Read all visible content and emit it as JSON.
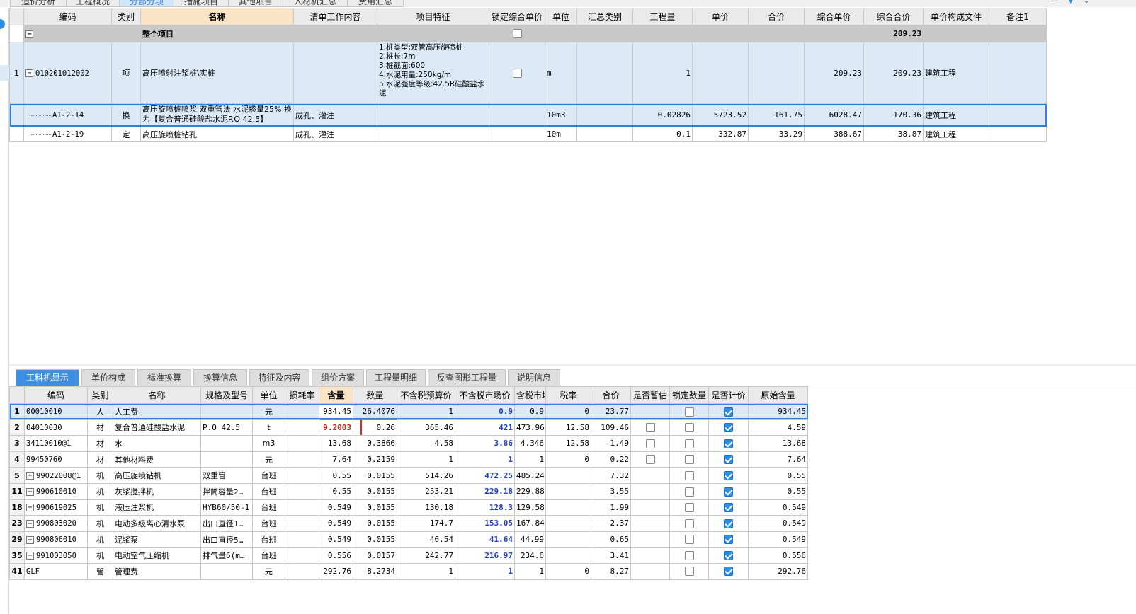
{
  "top_tabs": [
    "造价分析",
    "工程概况",
    "分部分项",
    "措施项目",
    "其他项目",
    "人材机汇总",
    "费用汇总"
  ],
  "upper": {
    "headers": [
      "编码",
      "类别",
      "名称",
      "清单工作内容",
      "项目特征",
      "锁定综合单价",
      "单位",
      "汇总类别",
      "工程量",
      "单价",
      "合价",
      "综合单价",
      "综合合价",
      "单价构成文件",
      "备注1"
    ],
    "whole": {
      "label": "整个项目",
      "total": "209.23"
    },
    "item": {
      "row_num": "1",
      "code": "010201012002",
      "type": "项",
      "name": "高压喷射注浆桩\\实桩",
      "features": "1.桩类型:双管高压旋喷桩\n2.桩长:7m\n3.桩截面:600\n4.水泥用量:250kg/m\n5.水泥强度等级:42.5R硅酸盐水泥",
      "unit": "m",
      "qty": "1",
      "comp_price": "209.23",
      "comp_total": "209.23",
      "file": "建筑工程"
    },
    "subs": [
      {
        "code": "A1-2-14",
        "type": "换",
        "name": "高压旋喷桩喷浆 双重管法 水泥掺量25% 换为【复合普通硅酸盐水泥P.O 42.5】",
        "work": "成孔、灌注",
        "unit": "10m3",
        "qty": "0.02826",
        "price": "5723.52",
        "total": "161.75",
        "comp_price": "6028.47",
        "comp_total": "170.36",
        "file": "建筑工程"
      },
      {
        "code": "A1-2-19",
        "type": "定",
        "name": "高压旋喷桩钻孔",
        "work": "成孔、灌注",
        "unit": "10m",
        "qty": "0.1",
        "price": "332.87",
        "total": "33.29",
        "comp_price": "388.67",
        "comp_total": "38.87",
        "file": "建筑工程"
      }
    ]
  },
  "lower_tabs": [
    "工料机显示",
    "单价构成",
    "标准换算",
    "换算信息",
    "特征及内容",
    "组价方案",
    "工程量明细",
    "反查图形工程量",
    "说明信息"
  ],
  "lower": {
    "headers": [
      "编码",
      "类别",
      "名称",
      "规格及型号",
      "单位",
      "损耗率",
      "含量",
      "数量",
      "不含税预算价",
      "不含税市场价",
      "含税市场价",
      "税率",
      "合价",
      "是否暂估",
      "锁定数量",
      "是否计价",
      "原始含量"
    ],
    "rows": [
      {
        "n": "1",
        "code": "00010010",
        "type": "人",
        "name": "人工费",
        "spec": "",
        "unit": "元",
        "content": "934.45",
        "qty": "26.4076",
        "pre": "1",
        "mkt": "0.9",
        "mkt_tax": "0.9",
        "tax": "0",
        "total": "23.77",
        "orig": "934.45"
      },
      {
        "n": "2",
        "code": "04010030",
        "type": "材",
        "name": "复合普通硅酸盐水泥",
        "spec": "P.O 42.5",
        "unit": "t",
        "content": "9.2003",
        "qty": "0.26",
        "pre": "365.46",
        "mkt": "421",
        "mkt_tax": "473.962",
        "tax": "12.58",
        "total": "109.46",
        "orig": "4.59"
      },
      {
        "n": "3",
        "code": "34110010@1",
        "type": "材",
        "name": "水",
        "spec": "",
        "unit": "m3",
        "content": "13.68",
        "qty": "0.3866",
        "pre": "4.58",
        "mkt": "3.86",
        "mkt_tax": "4.346",
        "tax": "12.58",
        "total": "1.49",
        "orig": "13.68"
      },
      {
        "n": "4",
        "code": "99450760",
        "type": "材",
        "name": "其他材料费",
        "spec": "",
        "unit": "元",
        "content": "7.64",
        "qty": "0.2159",
        "pre": "1",
        "mkt": "1",
        "mkt_tax": "1",
        "tax": "0",
        "total": "0.22",
        "orig": "7.64"
      },
      {
        "n": "5",
        "code": "99022008@1",
        "type": "机",
        "name": "高压旋喷钻机",
        "spec": "双重管",
        "unit": "台班",
        "content": "0.55",
        "qty": "0.0155",
        "pre": "514.26",
        "mkt": "472.25",
        "mkt_tax": "485.24",
        "tax": "",
        "total": "7.32",
        "orig": "0.55"
      },
      {
        "n": "11",
        "code": "990610010",
        "type": "机",
        "name": "灰浆搅拌机",
        "spec": "拌筒容量2…",
        "unit": "台班",
        "content": "0.55",
        "qty": "0.0155",
        "pre": "253.21",
        "mkt": "229.18",
        "mkt_tax": "229.88",
        "tax": "",
        "total": "3.55",
        "orig": "0.55"
      },
      {
        "n": "18",
        "code": "990619025",
        "type": "机",
        "name": "液压注浆机",
        "spec": "HYB60/50-1",
        "unit": "台班",
        "content": "0.549",
        "qty": "0.0155",
        "pre": "130.18",
        "mkt": "128.3",
        "mkt_tax": "129.58",
        "tax": "",
        "total": "1.99",
        "orig": "0.549"
      },
      {
        "n": "23",
        "code": "990803020",
        "type": "机",
        "name": "电动多级离心清水泵",
        "spec": "出口直径1…",
        "unit": "台班",
        "content": "0.549",
        "qty": "0.0155",
        "pre": "174.7",
        "mkt": "153.05",
        "mkt_tax": "167.84",
        "tax": "",
        "total": "2.37",
        "orig": "0.549"
      },
      {
        "n": "29",
        "code": "990806010",
        "type": "机",
        "name": "泥浆泵",
        "spec": "出口直径5…",
        "unit": "台班",
        "content": "0.549",
        "qty": "0.0155",
        "pre": "46.54",
        "mkt": "41.64",
        "mkt_tax": "44.99",
        "tax": "",
        "total": "0.65",
        "orig": "0.549"
      },
      {
        "n": "35",
        "code": "991003050",
        "type": "机",
        "name": "电动空气压缩机",
        "spec": "排气量6(m…",
        "unit": "台班",
        "content": "0.556",
        "qty": "0.0157",
        "pre": "242.77",
        "mkt": "216.97",
        "mkt_tax": "234.6",
        "tax": "",
        "total": "3.41",
        "orig": "0.556"
      },
      {
        "n": "41",
        "code": "GLF",
        "type": "管",
        "name": "管理费",
        "spec": "",
        "unit": "元",
        "content": "292.76",
        "qty": "8.2734",
        "pre": "1",
        "mkt": "1",
        "mkt_tax": "1",
        "tax": "0",
        "total": "8.27",
        "orig": "292.76"
      }
    ]
  }
}
